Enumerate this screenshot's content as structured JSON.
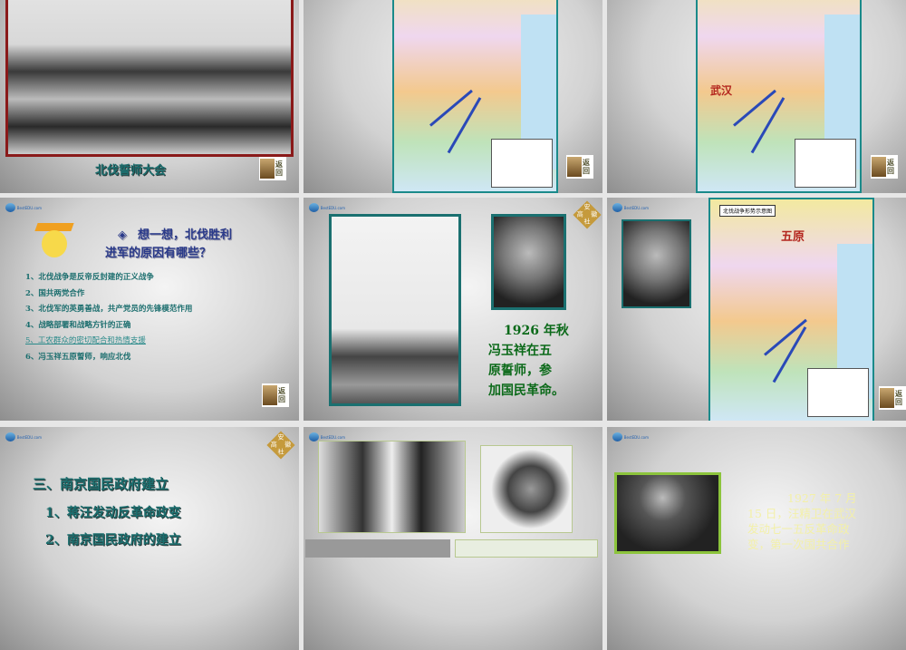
{
  "logo_text": "BestEDU.com",
  "back_label": "返回",
  "seal_chars": [
    "安",
    "徽",
    "高",
    "社"
  ],
  "slides": [
    {
      "caption": "北伐誓师大会"
    },
    {
      "map_title": ""
    },
    {
      "map_label": "武汉"
    },
    {
      "title_line1": "想一想，北伐胜利",
      "title_line2": "进军的原因有哪些？",
      "items": [
        "1、北伐战争是反帝反封建的正义战争",
        "2、国共两党合作",
        "3、北伐军的英勇善战，共产党员的先锋模范作用",
        "4、战略部署和战略方针的正确",
        "5、工农群众的密切配合和热情支援",
        "6、冯玉祥五原誓师，响应北伐"
      ]
    },
    {
      "text": [
        "1926 年秋",
        "冯玉祥在五",
        "原誓师，参",
        "加国民革命。"
      ]
    },
    {
      "map_title": "北伐战争形势示意图",
      "map_label": "五原"
    },
    {
      "heading": "三、南京国民政府建立",
      "items": [
        "1、蒋汪发动反革命政变",
        "2、南京国民政府的建立"
      ]
    },
    {},
    {
      "text": [
        "1927 年 7 月",
        "15 日，汪精卫在武汉",
        "发动七一五反革命政",
        "变，第一次国共合作"
      ]
    }
  ]
}
